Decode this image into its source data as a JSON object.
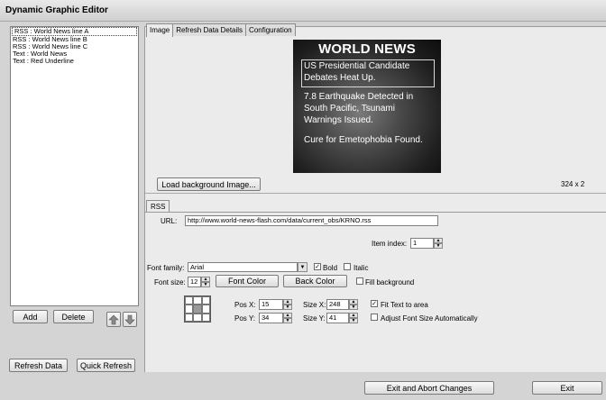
{
  "window": {
    "title": "Dynamic Graphic Editor"
  },
  "layers": [
    "RSS : World News line A",
    "RSS : World News line B",
    "RSS : World News line C",
    "Text : World News",
    "Text : Red Underline"
  ],
  "left_buttons": {
    "add": "Add",
    "delete": "Delete",
    "refresh_data": "Refresh Data",
    "quick_refresh": "Quick Refresh"
  },
  "tabs": [
    "Image",
    "Refresh Data Details",
    "Configuration"
  ],
  "preview": {
    "heading": "WORLD NEWS",
    "line1a": "US Presidential Candidate",
    "line1b": "Debates Heat Up.",
    "line2a": "7.8 Earthquake Detected in",
    "line2b": "South Pacific, Tsunami",
    "line2c": "Warnings Issued.",
    "line3": "Cure for Emetophobia Found."
  },
  "image_panel": {
    "load_button": "Load background Image...",
    "size_text": "324 x 2"
  },
  "rss": {
    "tab": "RSS",
    "url_label": "URL:",
    "url_value": "http://www.world-news-flash.com/data/current_obs/KRNO.rss",
    "item_index_label": "Item index:",
    "item_index_value": "1",
    "font_family_label": "Font family:",
    "font_family_value": "Arial",
    "bold_label": "Bold",
    "bold_checked": true,
    "italic_label": "Italic",
    "italic_checked": false,
    "font_size_label": "Font size:",
    "font_size_value": "12",
    "font_color_button": "Font Color",
    "back_color_button": "Back Color",
    "fill_background_label": "Fill background",
    "fill_background_checked": false,
    "pos_x_label": "Pos X:",
    "pos_x_value": "15",
    "pos_y_label": "Pos Y:",
    "pos_y_value": "34",
    "size_x_label": "Size X:",
    "size_x_value": "248",
    "size_y_label": "Size Y:",
    "size_y_value": "41",
    "fit_text_label": "Fit Text to area",
    "fit_text_checked": true,
    "adjust_font_label": "Adjust Font Size Automatically",
    "adjust_font_checked": false
  },
  "bottom_buttons": {
    "exit_abort": "Exit and Abort Changes",
    "exit": "Exit"
  }
}
